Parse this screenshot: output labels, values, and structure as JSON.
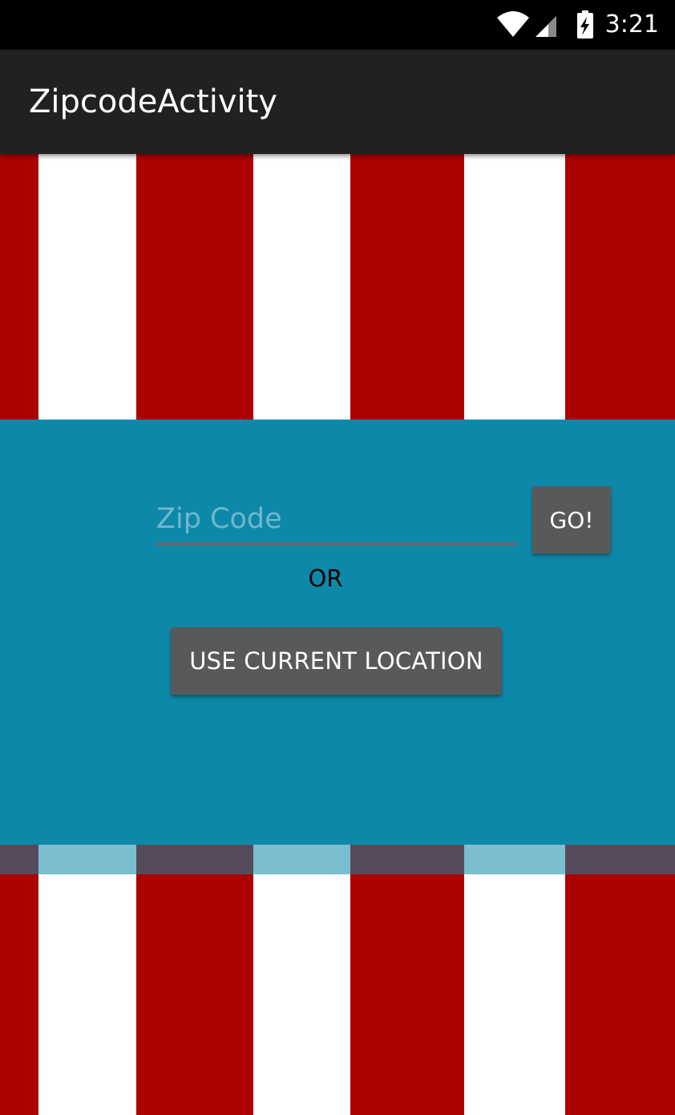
{
  "status_bar": {
    "time": "3:21",
    "icons": [
      "wifi-icon",
      "signal-icon",
      "battery-charging-icon"
    ]
  },
  "app_bar": {
    "title": "ZipcodeActivity"
  },
  "form": {
    "zip_placeholder": "Zip Code",
    "zip_value": "",
    "go_label": "GO!",
    "or_label": "OR",
    "location_label": "USE CURRENT LOCATION"
  },
  "colors": {
    "status_bar": "#000000",
    "app_bar": "#212121",
    "stripe_red": "#ad0000",
    "stripe_white": "#ffffff",
    "panel": "#0e88a8",
    "button": "#59595b"
  }
}
